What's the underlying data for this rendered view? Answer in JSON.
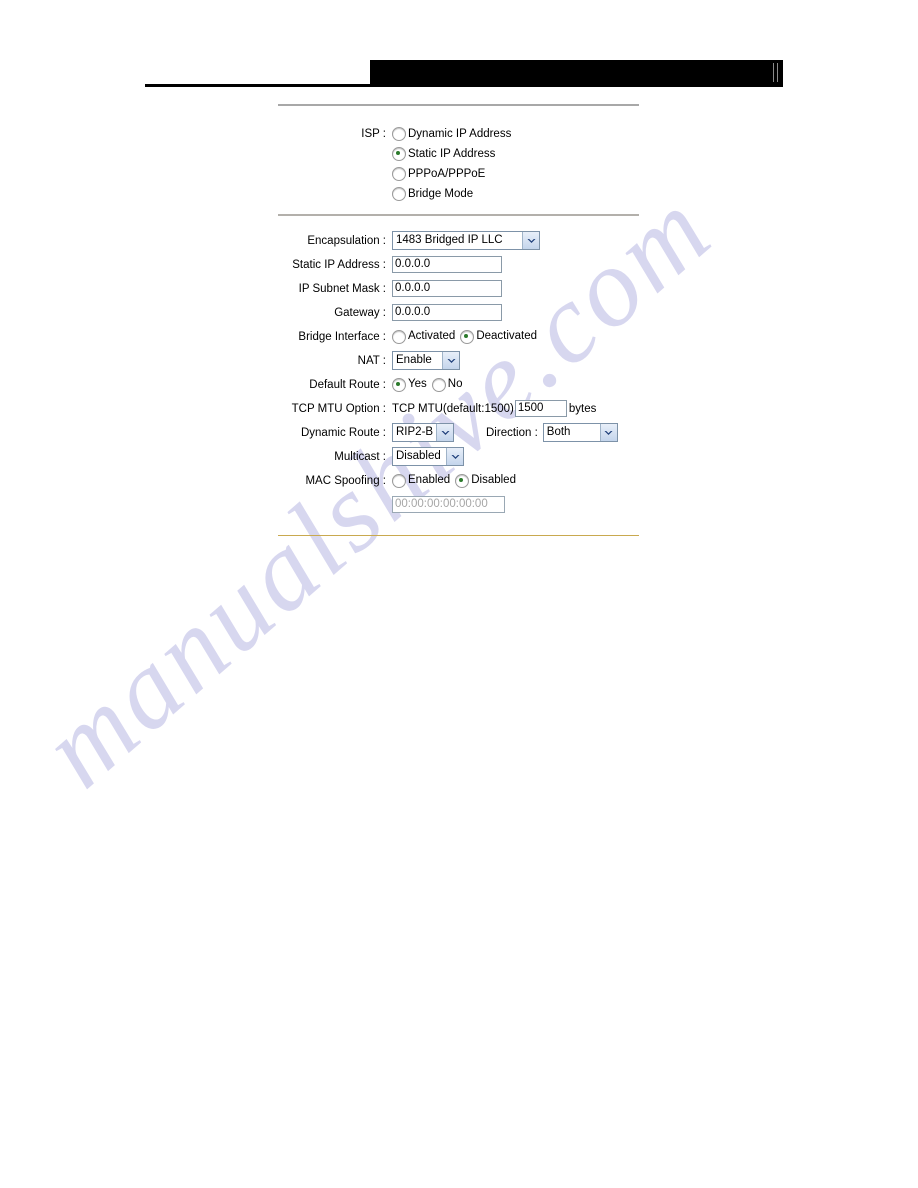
{
  "header": {
    "redacted_bar": "",
    "note": ""
  },
  "isp": {
    "label": "ISP :",
    "options": [
      {
        "label": "Dynamic IP Address",
        "selected": false
      },
      {
        "label": "Static IP Address",
        "selected": true
      },
      {
        "label": "PPPoA/PPPoE",
        "selected": false
      },
      {
        "label": "Bridge Mode",
        "selected": false
      }
    ]
  },
  "fields": {
    "encapsulation": {
      "label": "Encapsulation :",
      "value": "1483 Bridged IP LLC"
    },
    "static_ip_address": {
      "label": "Static IP Address :",
      "value": "0.0.0.0"
    },
    "ip_subnet_mask": {
      "label": "IP Subnet Mask :",
      "value": "0.0.0.0"
    },
    "gateway": {
      "label": "Gateway :",
      "value": "0.0.0.0"
    },
    "bridge_interface": {
      "label": "Bridge Interface :",
      "options": [
        {
          "label": "Activated",
          "selected": false
        },
        {
          "label": "Deactivated",
          "selected": true
        }
      ]
    },
    "nat": {
      "label": "NAT :",
      "value": "Enable"
    },
    "default_route": {
      "label": "Default Route :",
      "options": [
        {
          "label": "Yes",
          "selected": true
        },
        {
          "label": "No",
          "selected": false
        }
      ]
    },
    "tcp_mtu_option": {
      "label": "TCP MTU Option :",
      "prefix": "TCP MTU(default:1500)",
      "value": "1500",
      "suffix": "bytes"
    },
    "dynamic_route": {
      "label": "Dynamic Route :",
      "value": "RIP2-B"
    },
    "direction": {
      "label": "Direction :",
      "value": "Both"
    },
    "multicast": {
      "label": "Multicast :",
      "value": "Disabled"
    },
    "mac_spoofing": {
      "label": "MAC Spoofing :",
      "options": [
        {
          "label": "Enabled",
          "selected": false
        },
        {
          "label": "Disabled",
          "selected": true
        }
      ],
      "mac_value": "00:00:00:00:00:00"
    }
  },
  "watermark": {
    "text": "manualshive.com"
  },
  "colors": {
    "footer_rule": "#c9a94f",
    "divider": "#a8a8a8",
    "radio_dot": "#2c7a2c",
    "watermark": "#c9c8ea"
  }
}
